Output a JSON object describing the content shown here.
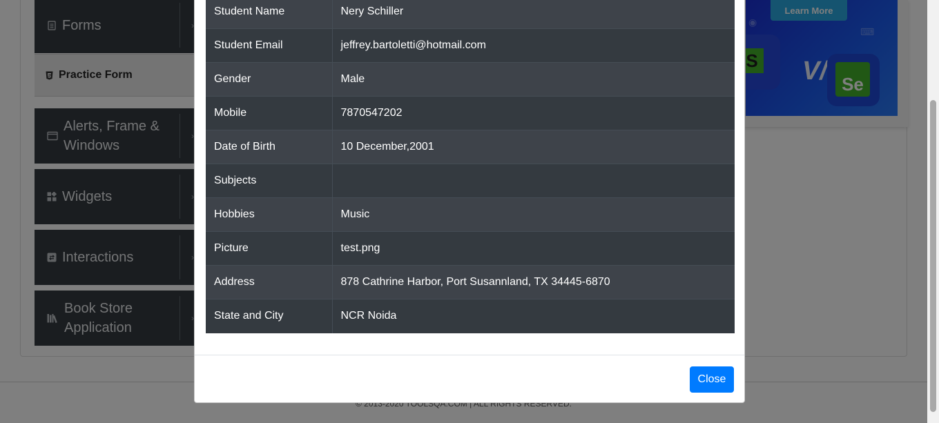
{
  "sidebar": {
    "groups": [
      {
        "label": "Forms",
        "icon": "document-icon"
      },
      {
        "label": "Alerts, Frame & Windows",
        "icon": "window-icon"
      },
      {
        "label": "Widgets",
        "icon": "widgets-icon"
      },
      {
        "label": "Interactions",
        "icon": "interactions-icon"
      },
      {
        "label": "Book Store Application",
        "icon": "book-icon"
      }
    ],
    "active_item": {
      "label": "Practice Form",
      "icon": "html5-icon"
    }
  },
  "banner": {
    "button_label": "Learn More",
    "vs_text": "V/s",
    "left_logo_text": "S",
    "right_logo_text": "Se"
  },
  "footer": {
    "copyright": "© 2013-2020 TOOLSQA.COM | ALL RIGHTS RESERVED."
  },
  "modal": {
    "rows": [
      {
        "label": "Student Name",
        "value": "Nery Schiller"
      },
      {
        "label": "Student Email",
        "value": "jeffrey.bartoletti@hotmail.com"
      },
      {
        "label": "Gender",
        "value": "Male"
      },
      {
        "label": "Mobile",
        "value": "7870547202"
      },
      {
        "label": "Date of Birth",
        "value": "10 December,2001"
      },
      {
        "label": "Subjects",
        "value": ""
      },
      {
        "label": "Hobbies",
        "value": "Music"
      },
      {
        "label": "Picture",
        "value": "test.png"
      },
      {
        "label": "Address",
        "value": "878 Cathrine Harbor, Port Susannland, TX 34445-6870"
      },
      {
        "label": "State and City",
        "value": "NCR Noida"
      }
    ],
    "close_label": "Close"
  },
  "colors": {
    "accent": "#007bff",
    "table_dark": "#343a40",
    "table_stripe": "#3e434a",
    "overlay": "rgba(0,0,0,0.5)"
  }
}
